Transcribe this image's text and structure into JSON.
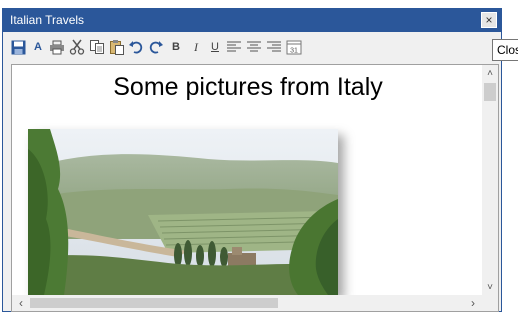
{
  "window": {
    "title": "Italian Travels",
    "close_symbol": "×",
    "tooltip": "Close"
  },
  "toolbar": {
    "icons": [
      "save-icon",
      "font-icon",
      "print-icon",
      "cut-icon",
      "copy-icon",
      "paste-icon",
      "undo-icon",
      "redo-icon",
      "bold-icon",
      "italic-icon",
      "underline-icon",
      "align-left-icon",
      "align-center-icon",
      "align-right-icon",
      "insert-date-icon"
    ],
    "font_label": "A",
    "bold_label": "B",
    "italic_label": "I",
    "underline_label": "U",
    "date_label": "31"
  },
  "document": {
    "heading": "Some pictures from Italy"
  },
  "scrollbars": {
    "up_arrow": "˄",
    "down_arrow": "˅",
    "left_arrow": "‹",
    "right_arrow": "›"
  },
  "colors": {
    "titlebar": "#2b579a",
    "accent": "#2b579a"
  }
}
